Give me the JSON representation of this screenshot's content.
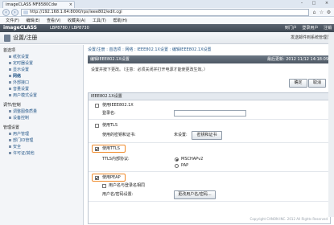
{
  "browser": {
    "tab_title": "imageCLASS MF8580Cdw",
    "url": "http://192.168.1.64:8000/rps/ieee802/edit.cgi",
    "menu": [
      "文件(F)",
      "编辑(E)",
      "查看(V)",
      "收藏夹(A)",
      "工具(T)",
      "帮助(H)"
    ]
  },
  "brand": {
    "name": "imageCLASS",
    "device": "LBP8780 / LBP8730",
    "right_links": [
      "到门户",
      "登录用户",
      "注销"
    ]
  },
  "header": {
    "title": "设置/注册",
    "right_text": "发送邮件到系统管理员"
  },
  "sidebar": {
    "sections": [
      {
        "title": "首选项",
        "items": [
          "纸张设置",
          "定时器设置",
          "显示设置",
          "网络",
          "外部接口",
          "音量设置",
          "用户模式设置"
        ]
      },
      {
        "title": "调节/控制",
        "items": [
          "调整图像质量",
          "设备控制"
        ]
      },
      {
        "title": "管理设置",
        "items": [
          "用户管理",
          "部门ID管理",
          "安全",
          "许可证/其他"
        ]
      }
    ]
  },
  "main": {
    "breadcrumb": "设置/注册 : 首选项 : 网络 : IEEE802.1X设置 : 编辑IEEE802.1X设置",
    "section_title": "编辑IEEE802.1X设置",
    "date": "最后更新: 2012 11/12 14:18:09",
    "note": "设置并按下更改。（注意：必须关闭并打开电源才能使更改生效。）",
    "ok_label": "确定",
    "cancel_label": "取消",
    "panel_title": "IEEE802.1X设置",
    "use_ieee_label": "使用IEEE802.1X",
    "login_name_label": "登录名:",
    "use_tls_label": "使用TLS",
    "key_cert_label": "使用的密钥和证书:",
    "key_none": "未设置:",
    "key_button": "密钥和证书",
    "use_ttls_label": "使用TTLS",
    "ttls_protocol_label": "TTLS内部协议:",
    "mschap_label": "MSCHAPv2",
    "pap_label": "PAP",
    "use_peap_label": "使用PEAP",
    "user_name_label": "用户名与登录名相同",
    "user_pwd_label": "用户名/密码设置:",
    "user_pwd_button": "更改用户名/密码...",
    "footer": "Copyright CANON INC. 2012 All Rights Reserved"
  },
  "colors": {
    "highlight": "#f08a2a",
    "brand_bar": "#3f4852",
    "link": "#2b5c8c"
  }
}
